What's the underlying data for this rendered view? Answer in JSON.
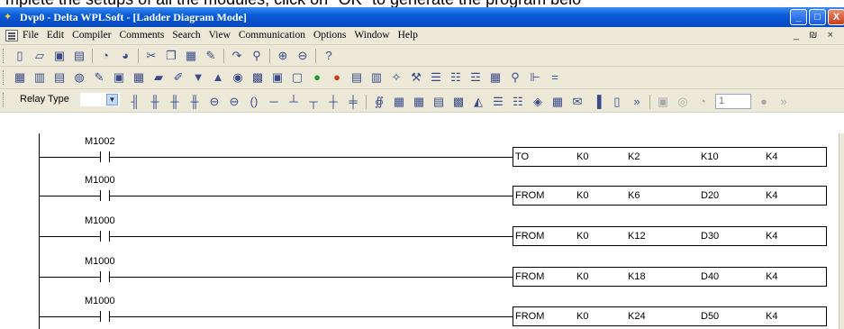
{
  "caption_fragment": "mplete the setups of all the modules, click on \"OK\" to generate the program belo",
  "window": {
    "title": "Dvp0 - Delta WPLSoft - [Ladder Diagram Mode]",
    "buttons": {
      "minimize": "_",
      "maximize": "□",
      "close": "X"
    }
  },
  "menu": {
    "items": [
      "File",
      "Edit",
      "Compiler",
      "Comments",
      "Search",
      "View",
      "Communication",
      "Options",
      "Window",
      "Help"
    ],
    "mdi_controls": "_ ₪ ×"
  },
  "toolbar1": {
    "icons": [
      "new-file-icon",
      "open-folder-icon",
      "save-icon",
      "save-all-icon",
      "undo-icon",
      "redo-icon",
      "cut-icon",
      "copy-icon",
      "paste-icon",
      "eraser-icon",
      "jump-icon",
      "search-icon",
      "zoom-in-icon",
      "zoom-out-icon",
      "help-icon"
    ]
  },
  "toolbar3": {
    "relay_type_label": "Relay Type",
    "relay_type_value": "",
    "function_keys": [
      "F1",
      "F2",
      "F3",
      "F4",
      "F5",
      "F6",
      "F7",
      "F8",
      "F9",
      "F10",
      "F11",
      "F12"
    ],
    "stepper_value": "1"
  },
  "ladder": {
    "rungs": [
      {
        "contact": "M1002",
        "instruction": "TO",
        "op1": "K0",
        "op2": "K2",
        "op3": "K10",
        "op4": "K4"
      },
      {
        "contact": "M1000",
        "instruction": "FROM",
        "op1": "K0",
        "op2": "K6",
        "op3": "D20",
        "op4": "K4"
      },
      {
        "contact": "M1000",
        "instruction": "FROM",
        "op1": "K0",
        "op2": "K12",
        "op3": "D30",
        "op4": "K4"
      },
      {
        "contact": "M1000",
        "instruction": "FROM",
        "op1": "K0",
        "op2": "K18",
        "op3": "D40",
        "op4": "K4"
      },
      {
        "contact": "M1000",
        "instruction": "FROM",
        "op1": "K0",
        "op2": "K24",
        "op3": "D50",
        "op4": "K4"
      }
    ]
  },
  "colors": {
    "titlebar": "#0a5bd6",
    "chrome": "#ece9d8",
    "canvas": "#ffffff"
  }
}
